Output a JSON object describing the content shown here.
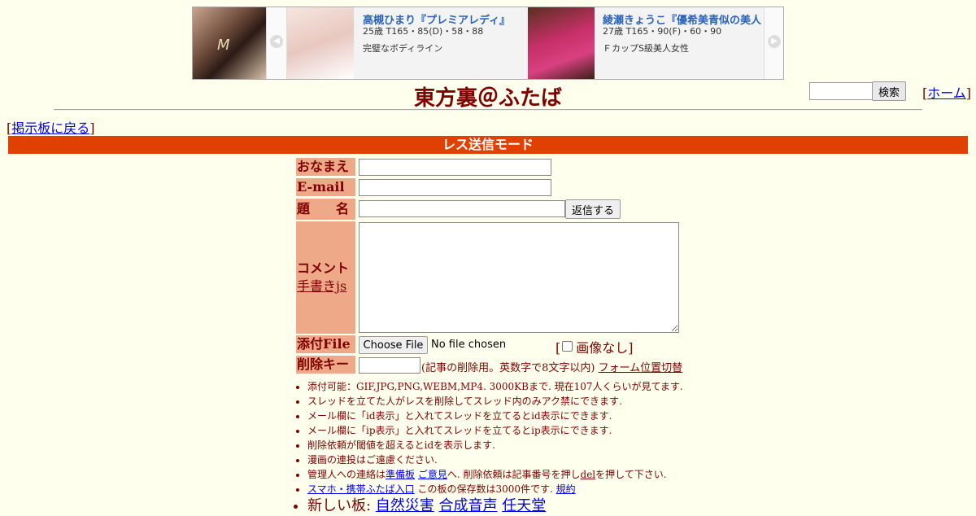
{
  "banner": {
    "logo_text": "M",
    "cards": [
      {
        "name": "高槻ひまり『プレミアレディ』",
        "spec": "25歳 T165・85(D)・58・88",
        "desc": "完璧なボディライン"
      },
      {
        "name": "綾瀬きょうこ『優希美青似の美人",
        "spec": "27歳 T165・90(F)・60・90",
        "desc": "ＦカップS級美人女性"
      }
    ],
    "prev_arrow": "◀",
    "next_arrow": "▶"
  },
  "header": {
    "title": "東方裏＠ふたば",
    "search_button": "検索",
    "home_bracket_open": "[",
    "home_link": "ホーム",
    "home_bracket_close": "]"
  },
  "nav": {
    "bracket_open": "[",
    "back_link": "掲示板に戻る",
    "bracket_close": "]"
  },
  "mode_bar": "レス送信モード",
  "form": {
    "name_label": "おなまえ",
    "email_label": "E-mail",
    "subject_label": "題　　名",
    "submit_button": "返信する",
    "comment_label": "コメント",
    "handwrite_link": "手書きjs",
    "file_label": "添付File",
    "choose_file_button": "Choose File",
    "no_file_text": "No file chosen",
    "noimg_open": "[",
    "noimg_label": "画像なし",
    "noimg_close": "]",
    "delkey_label": "削除キー",
    "delkey_note": "(記事の削除用。英数字で8文字以内)",
    "form_position_link": "フォーム位置切替"
  },
  "notes": {
    "n1": "添付可能：GIF,JPG,PNG,WEBM,MP4. 3000KBまで. 現在107人くらいが見てます.",
    "n2": "スレッドを立てた人がレスを削除してスレッド内のみアク禁にできます.",
    "n3": "メール欄に「id表示」と入れてスレッドを立てるとid表示にできます.",
    "n4": "メール欄に「ip表示」と入れてスレッドを立てるとip表示にできます.",
    "n5": "削除依頼が閾値を超えるとidを表示します.",
    "n6": "漫画の連投はご遠慮ください.",
    "n7_pre": "管理人への連絡は",
    "n7_link1": "準備板",
    "n7_link2": "ご意見",
    "n7_mid": "へ. 削除依頼は記事番号を押し",
    "n7_link3": "del",
    "n7_post": "を押して下さい.",
    "n8_link1": "スマホ・携帯ふたば入口",
    "n8_mid": " この板の保存数は3000件です. ",
    "n8_link2": "規約",
    "n9_label": "新しい板: ",
    "n9_boards": [
      "自然災害",
      "合成音声",
      "任天堂"
    ]
  }
}
